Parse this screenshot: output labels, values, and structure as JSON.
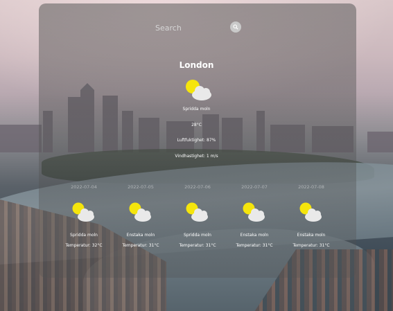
{
  "search": {
    "placeholder": "Search"
  },
  "current": {
    "city": "London",
    "icon": "partly-cloudy-icon",
    "description": "Spridda moln",
    "temperature": "28°C",
    "humidity": "Luftfuktighet: 87%",
    "wind": "Vindhastighet: 1 m/s"
  },
  "forecast": [
    {
      "date": "2022-07-04",
      "icon": "partly-cloudy-icon",
      "description": "Spridda moln",
      "temperature": "Temperatur: 32°C"
    },
    {
      "date": "2022-07-05",
      "icon": "partly-cloudy-icon",
      "description": "Enstaka moln",
      "temperature": "Temperatur: 31°C"
    },
    {
      "date": "2022-07-06",
      "icon": "partly-cloudy-icon",
      "description": "Spridda moln",
      "temperature": "Temperatur: 31°C"
    },
    {
      "date": "2022-07-07",
      "icon": "partly-cloudy-icon",
      "description": "Enstaka moln",
      "temperature": "Temperatur: 31°C"
    },
    {
      "date": "2022-07-08",
      "icon": "partly-cloudy-icon",
      "description": "Enstaka moln",
      "temperature": "Temperatur: 31°C"
    }
  ],
  "colors": {
    "sun": "#f5e50c",
    "cloud": "#e9e9e9",
    "panel": "#505050"
  }
}
